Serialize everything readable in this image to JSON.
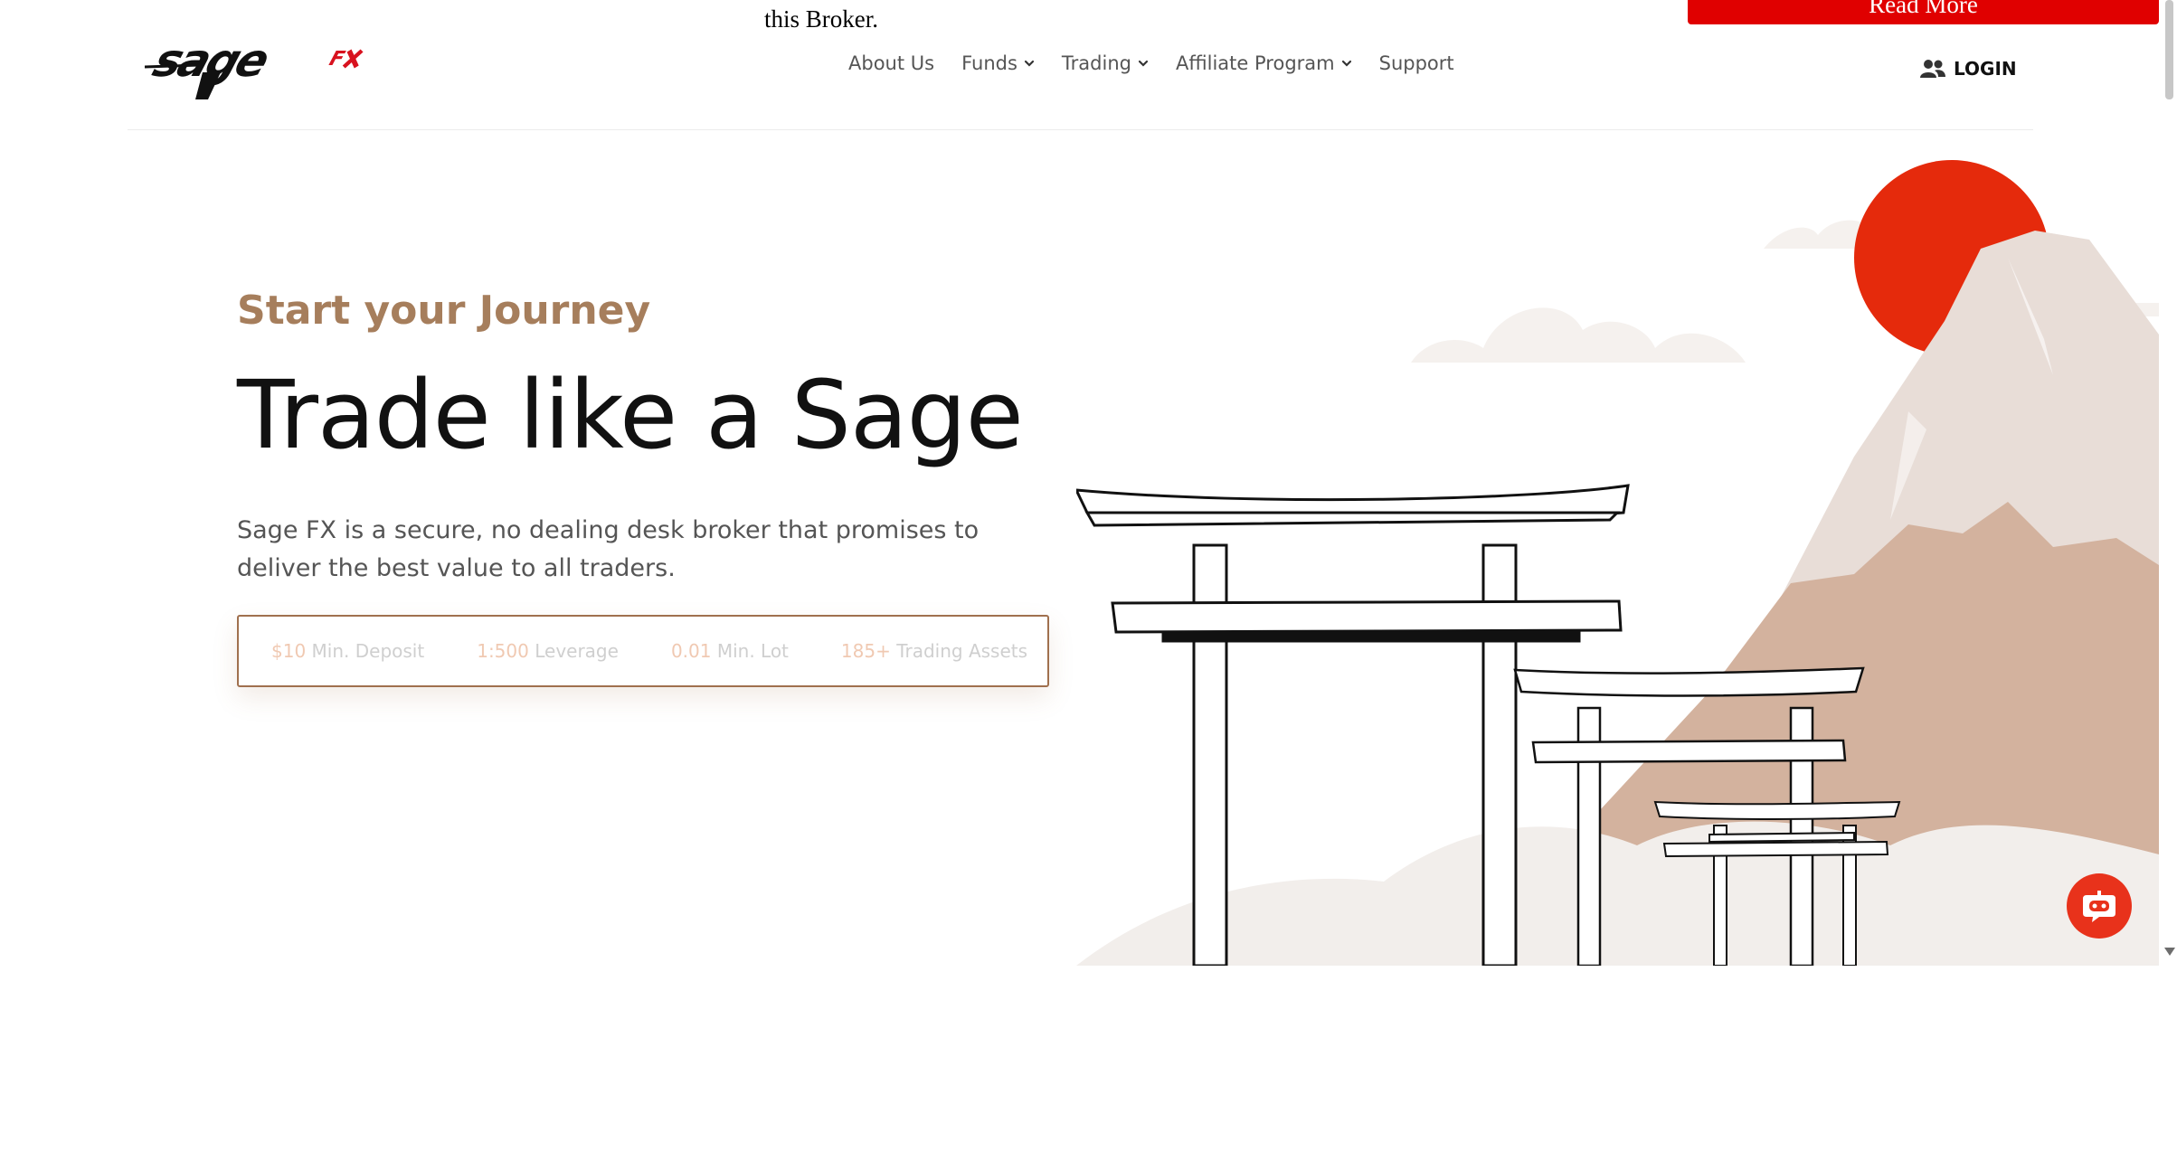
{
  "notice": {
    "text": "this Broker.",
    "button_label": "Read More"
  },
  "nav": {
    "items": [
      {
        "label": "About Us",
        "has_dropdown": false
      },
      {
        "label": "Funds",
        "has_dropdown": true
      },
      {
        "label": "Trading",
        "has_dropdown": true
      },
      {
        "label": "Affiliate Program",
        "has_dropdown": true
      },
      {
        "label": "Support",
        "has_dropdown": false
      }
    ],
    "login_label": "LOGIN",
    "login_icon": "users-icon"
  },
  "hero": {
    "eyebrow": "Start your Journey",
    "headline": "Trade like a Sage",
    "description": "Sage FX is a secure, no dealing desk broker that promises to deliver the best value to all traders.",
    "stats": [
      {
        "value": "$10",
        "label": "Min. Deposit"
      },
      {
        "value": "1:500",
        "label": "Leverage"
      },
      {
        "value": "0.01",
        "label": "Min. Lot"
      },
      {
        "value": "185+",
        "label": "Trading Assets"
      }
    ]
  },
  "colors": {
    "accent": "#a67e5c",
    "brand_red": "#e00000",
    "sun": "#e52a0c",
    "chat": "#e8321b",
    "mountain": "#d3b29e"
  },
  "icons": {
    "chat": "chatbot-icon",
    "dropdown": "chevron-down-icon"
  }
}
